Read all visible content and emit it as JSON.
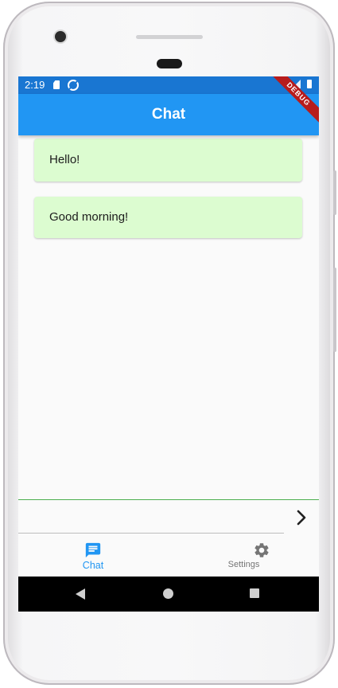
{
  "status_bar": {
    "time": "2:19",
    "color": "#1976d2"
  },
  "debug_banner": "DEBUG",
  "app_bar": {
    "title": "Chat",
    "color": "#2196f3"
  },
  "messages": [
    {
      "text": "Hello!"
    },
    {
      "text": "Good morning!"
    }
  ],
  "message_bubble_color": "#dcfcd0",
  "input": {
    "value": "",
    "placeholder": ""
  },
  "send_button": {
    "icon": "chevron-right-icon"
  },
  "bottom_nav": {
    "items": [
      {
        "label": "Chat",
        "icon": "chat-icon",
        "selected": true
      },
      {
        "label": "Settings",
        "icon": "gear-icon",
        "selected": false
      }
    ],
    "selected_color": "#2196f3",
    "unselected_color": "#757575"
  },
  "system_nav": {
    "buttons": [
      "back-icon",
      "home-icon",
      "recents-icon"
    ]
  }
}
